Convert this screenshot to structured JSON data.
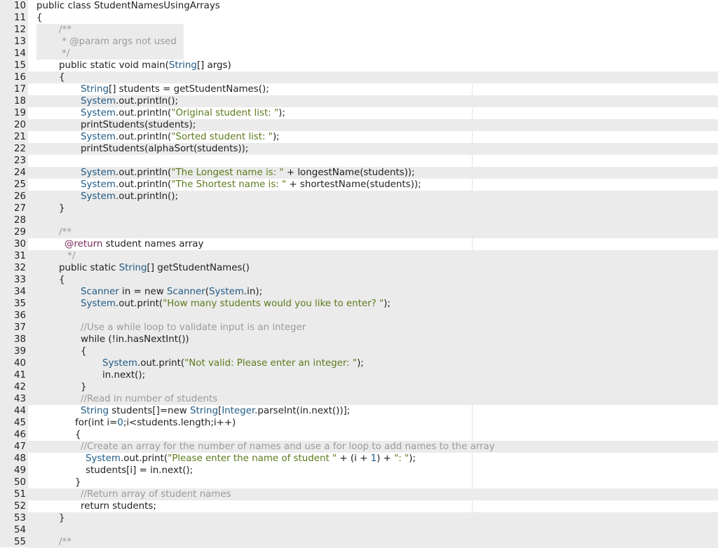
{
  "editor": {
    "lines": [
      {
        "n": "10",
        "text": "public class StudentNamesUsingArrays"
      },
      {
        "n": "11",
        "text": "{"
      },
      {
        "n": "12",
        "text": "/**"
      },
      {
        "n": "13",
        "text": " * @param args not used"
      },
      {
        "n": "14",
        "text": " */"
      },
      {
        "n": "15",
        "text": "public static void main(String[] args)"
      },
      {
        "n": "16",
        "text": "{"
      },
      {
        "n": "17",
        "text": "String[] students = getStudentNames();"
      },
      {
        "n": "18",
        "text": "System.out.println();"
      },
      {
        "n": "19",
        "text": "System.out.println(\"Original student list: \");"
      },
      {
        "n": "20",
        "text": "printStudents(students);"
      },
      {
        "n": "21",
        "text": "System.out.println(\"Sorted student list: \");"
      },
      {
        "n": "22",
        "text": "printStudents(alphaSort(students));"
      },
      {
        "n": "23",
        "text": ""
      },
      {
        "n": "24",
        "text": "System.out.println(\"The Longest name is: \" + longestName(students));"
      },
      {
        "n": "25",
        "text": "System.out.println(\"The Shortest name is: \" + shortestName(students));"
      },
      {
        "n": "26",
        "text": "System.out.println();"
      },
      {
        "n": "27",
        "text": "}"
      },
      {
        "n": "28",
        "text": ""
      },
      {
        "n": "29",
        "text": "/**"
      },
      {
        "n": "30",
        "text": "@return student names array"
      },
      {
        "n": "31",
        "text": " */"
      },
      {
        "n": "32",
        "text": "public static String[] getStudentNames()"
      },
      {
        "n": "33",
        "text": "{"
      },
      {
        "n": "34",
        "text": "Scanner in = new Scanner(System.in);"
      },
      {
        "n": "35",
        "text": "System.out.print(\"How many students would you like to enter? \");"
      },
      {
        "n": "36",
        "text": ""
      },
      {
        "n": "37",
        "text": "//Use a while loop to validate input is an integer"
      },
      {
        "n": "38",
        "text": "while (!in.hasNextInt())"
      },
      {
        "n": "39",
        "text": "{"
      },
      {
        "n": "40",
        "text": "System.out.print(\"Not valid: Please enter an integer: \");"
      },
      {
        "n": "41",
        "text": "in.next();"
      },
      {
        "n": "42",
        "text": "}"
      },
      {
        "n": "43",
        "text": "//Read in number of students"
      },
      {
        "n": "44",
        "text": "String students[]=new String[Integer.parseInt(in.next())];"
      },
      {
        "n": "45",
        "text": "for(int i=0;i<students.length;i++)"
      },
      {
        "n": "46",
        "text": "{"
      },
      {
        "n": "47",
        "text": "//Create an array for the number of names and use a for loop to add names to the array"
      },
      {
        "n": "48",
        "text": "System.out.print(\"Please enter the name of student \" + (i + 1) + \": \");"
      },
      {
        "n": "49",
        "text": "students[i] = in.next();"
      },
      {
        "n": "50",
        "text": "}"
      },
      {
        "n": "51",
        "text": "//Return array of student names"
      },
      {
        "n": "52",
        "text": "return students;"
      },
      {
        "n": "53",
        "text": "}"
      },
      {
        "n": "54",
        "text": ""
      },
      {
        "n": "55",
        "text": "/**"
      }
    ]
  }
}
